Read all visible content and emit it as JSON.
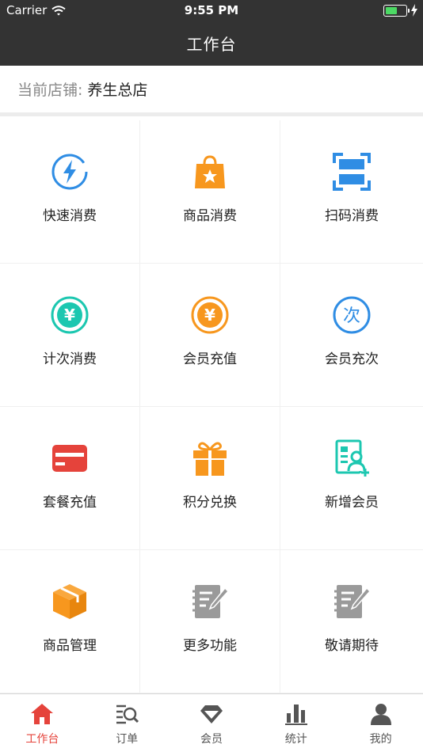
{
  "status_bar": {
    "carrier": "Carrier",
    "time": "9:55 PM",
    "battery_level": 0.6
  },
  "nav": {
    "title": "工作台"
  },
  "store": {
    "label": "当前店铺:",
    "name": "养生总店"
  },
  "functions": [
    {
      "label": "快速消费",
      "icon": "lightning-icon",
      "color": "#2f8de4"
    },
    {
      "label": "商品消费",
      "icon": "shopping-bag-icon",
      "color": "#f7971e"
    },
    {
      "label": "扫码消费",
      "icon": "scan-icon",
      "color": "#2f8de4"
    },
    {
      "label": "计次消费",
      "icon": "yen-coin-icon",
      "color": "#1cc7b0"
    },
    {
      "label": "会员充值",
      "icon": "yen-coin-icon",
      "color": "#f7971e"
    },
    {
      "label": "会员充次",
      "icon": "count-icon",
      "icon_text": "次",
      "color": "#2f8de4"
    },
    {
      "label": "套餐充值",
      "icon": "card-icon",
      "color": "#e5433b"
    },
    {
      "label": "积分兑换",
      "icon": "gift-icon",
      "color": "#f7971e"
    },
    {
      "label": "新增会员",
      "icon": "add-member-icon",
      "color": "#1cc7b0"
    },
    {
      "label": "商品管理",
      "icon": "box-icon",
      "color": "#f7971e"
    },
    {
      "label": "更多功能",
      "icon": "notebook-icon",
      "color": "#9a9a9a"
    },
    {
      "label": "敬请期待",
      "icon": "notebook-icon",
      "color": "#9a9a9a"
    }
  ],
  "tabs": [
    {
      "label": "工作台",
      "icon": "home-icon",
      "active": true
    },
    {
      "label": "订单",
      "icon": "order-search-icon",
      "active": false
    },
    {
      "label": "会员",
      "icon": "diamond-icon",
      "active": false
    },
    {
      "label": "统计",
      "icon": "bar-chart-icon",
      "active": false
    },
    {
      "label": "我的",
      "icon": "user-icon",
      "active": false
    }
  ],
  "colors": {
    "header_bg": "#333333",
    "accent": "#e5433b",
    "tab_inactive": "#555555"
  }
}
